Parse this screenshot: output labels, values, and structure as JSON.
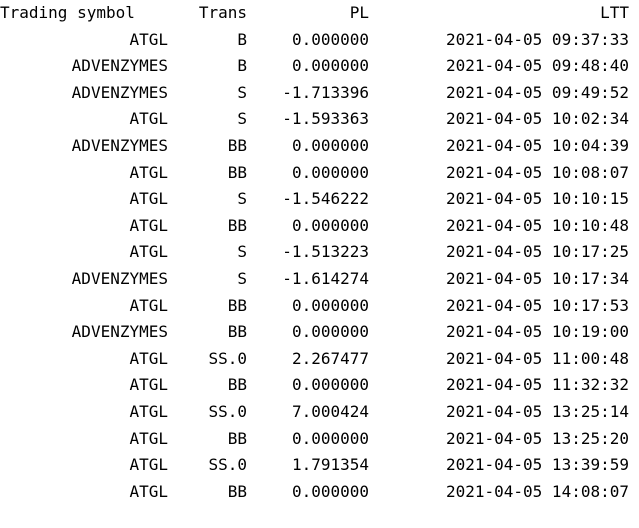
{
  "table": {
    "headers": {
      "symbol": "Trading symbol",
      "trans": "Trans",
      "pl": "PL",
      "ltt": "LTT"
    },
    "rows": [
      {
        "symbol": "ATGL",
        "trans": "B",
        "pl": "0.000000",
        "ltt": "2021-04-05 09:37:33"
      },
      {
        "symbol": "ADVENZYMES",
        "trans": "B",
        "pl": "0.000000",
        "ltt": "2021-04-05 09:48:40"
      },
      {
        "symbol": "ADVENZYMES",
        "trans": "S",
        "pl": "-1.713396",
        "ltt": "2021-04-05 09:49:52"
      },
      {
        "symbol": "ATGL",
        "trans": "S",
        "pl": "-1.593363",
        "ltt": "2021-04-05 10:02:34"
      },
      {
        "symbol": "ADVENZYMES",
        "trans": "BB",
        "pl": "0.000000",
        "ltt": "2021-04-05 10:04:39"
      },
      {
        "symbol": "ATGL",
        "trans": "BB",
        "pl": "0.000000",
        "ltt": "2021-04-05 10:08:07"
      },
      {
        "symbol": "ATGL",
        "trans": "S",
        "pl": "-1.546222",
        "ltt": "2021-04-05 10:10:15"
      },
      {
        "symbol": "ATGL",
        "trans": "BB",
        "pl": "0.000000",
        "ltt": "2021-04-05 10:10:48"
      },
      {
        "symbol": "ATGL",
        "trans": "S",
        "pl": "-1.513223",
        "ltt": "2021-04-05 10:17:25"
      },
      {
        "symbol": "ADVENZYMES",
        "trans": "S",
        "pl": "-1.614274",
        "ltt": "2021-04-05 10:17:34"
      },
      {
        "symbol": "ATGL",
        "trans": "BB",
        "pl": "0.000000",
        "ltt": "2021-04-05 10:17:53"
      },
      {
        "symbol": "ADVENZYMES",
        "trans": "BB",
        "pl": "0.000000",
        "ltt": "2021-04-05 10:19:00"
      },
      {
        "symbol": "ATGL",
        "trans": "SS.0",
        "pl": "2.267477",
        "ltt": "2021-04-05 11:00:48"
      },
      {
        "symbol": "ATGL",
        "trans": "BB",
        "pl": "0.000000",
        "ltt": "2021-04-05 11:32:32"
      },
      {
        "symbol": "ATGL",
        "trans": "SS.0",
        "pl": "7.000424",
        "ltt": "2021-04-05 13:25:14"
      },
      {
        "symbol": "ATGL",
        "trans": "BB",
        "pl": "0.000000",
        "ltt": "2021-04-05 13:25:20"
      },
      {
        "symbol": "ATGL",
        "trans": "SS.0",
        "pl": "1.791354",
        "ltt": "2021-04-05 13:39:59"
      },
      {
        "symbol": "ATGL",
        "trans": "BB",
        "pl": "0.000000",
        "ltt": "2021-04-05 14:08:07"
      }
    ]
  }
}
